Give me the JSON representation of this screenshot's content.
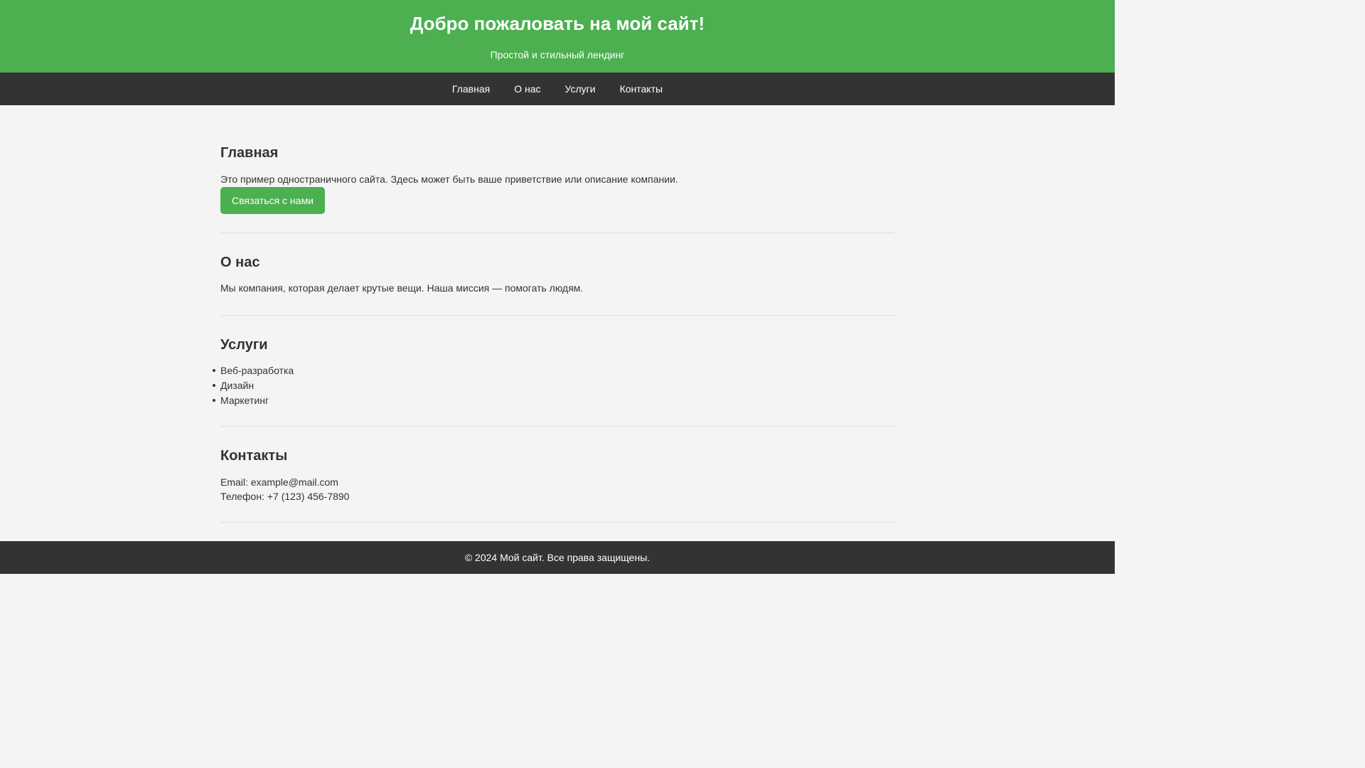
{
  "header": {
    "title": "Добро пожаловать на мой сайт!",
    "tagline": "Простой и стильный лендинг"
  },
  "nav": {
    "items": [
      {
        "label": "Главная"
      },
      {
        "label": "О нас"
      },
      {
        "label": "Услуги"
      },
      {
        "label": "Контакты"
      }
    ]
  },
  "sections": {
    "home": {
      "title": "Главная",
      "text": "Это пример одностраничного сайта. Здесь может быть ваше приветствие или описание компании.",
      "button_label": "Связаться с нами"
    },
    "about": {
      "title": "О нас",
      "text": "Мы компания, которая делает крутые вещи. Наша миссия — помогать людям."
    },
    "services": {
      "title": "Услуги",
      "items": [
        "Веб-разработка",
        "Дизайн",
        "Маркетинг"
      ]
    },
    "contacts": {
      "title": "Контакты",
      "email": "Email: example@mail.com",
      "phone": "Телефон: +7 (123) 456-7890"
    }
  },
  "footer": {
    "text": "© 2024 Мой сайт. Все права защищены."
  },
  "colors": {
    "accent": "#4caf50",
    "dark": "#333333",
    "background": "#f4f4f4"
  }
}
